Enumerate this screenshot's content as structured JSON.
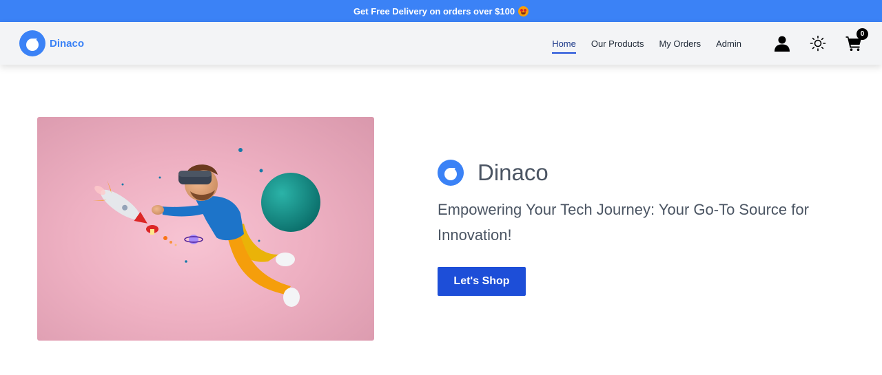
{
  "promo": {
    "text": "Get Free Delivery on orders over $100",
    "emoji_icon": "heart-eyes-emoji-icon"
  },
  "navbar": {
    "brand_name": "Dinaco",
    "brand_icon": "dinaco-logo-icon",
    "links": [
      {
        "label": "Home",
        "active": true
      },
      {
        "label": "Our Products",
        "active": false
      },
      {
        "label": "My Orders",
        "active": false
      },
      {
        "label": "Admin",
        "active": false
      }
    ],
    "icons": [
      "user-icon",
      "sun-icon",
      "cart-icon"
    ],
    "cart_count": "0"
  },
  "hero": {
    "title": "Dinaco",
    "tagline": "Empowering Your Tech Journey: Your Go-To Source for Innovation!",
    "cta_label": "Let's Shop",
    "image_description_icon": "vr-man-rocket-illustration"
  },
  "colors": {
    "promo_bg": "#3b82f6",
    "brand": "#3b82f6",
    "cta": "#1d4ed8",
    "navbar_bg": "#f3f4f6"
  }
}
